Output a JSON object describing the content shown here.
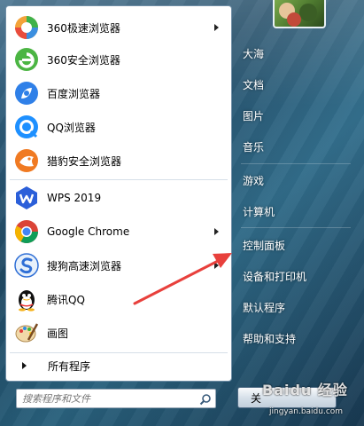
{
  "programs": [
    {
      "label": "360极速浏览器",
      "icon": "360-extreme-browser-icon",
      "has_submenu": true
    },
    {
      "label": "360安全浏览器",
      "icon": "360-safe-browser-icon",
      "has_submenu": false
    },
    {
      "label": "百度浏览器",
      "icon": "baidu-browser-icon",
      "has_submenu": false
    },
    {
      "label": "QQ浏览器",
      "icon": "qq-browser-icon",
      "has_submenu": false
    },
    {
      "label": "猎豹安全浏览器",
      "icon": "cheetah-browser-icon",
      "has_submenu": false
    },
    {
      "label": "WPS 2019",
      "icon": "wps-icon",
      "has_submenu": false
    },
    {
      "label": "Google Chrome",
      "icon": "chrome-icon",
      "has_submenu": true
    },
    {
      "label": "搜狗高速浏览器",
      "icon": "sogou-browser-icon",
      "has_submenu": true
    },
    {
      "label": "腾讯QQ",
      "icon": "qq-penguin-icon",
      "has_submenu": false
    },
    {
      "label": "画图",
      "icon": "paint-icon",
      "has_submenu": false
    }
  ],
  "all_programs_label": "所有程序",
  "search": {
    "placeholder": "搜索程序和文件"
  },
  "right_items": [
    {
      "label": "大海"
    },
    {
      "label": "文档"
    },
    {
      "label": "图片"
    },
    {
      "label": "音乐"
    },
    {
      "label": "游戏"
    },
    {
      "label": "计算机"
    },
    {
      "label": "控制面板"
    },
    {
      "label": "设备和打印机"
    },
    {
      "label": "默认程序"
    },
    {
      "label": "帮助和支持"
    }
  ],
  "shutdown_label": "关",
  "watermark": {
    "text": "Baidu 经验",
    "url": "jingyan.baidu.com"
  },
  "colors": {
    "annotation_arrow": "#e8403c",
    "accent": "#2d6b8a"
  }
}
